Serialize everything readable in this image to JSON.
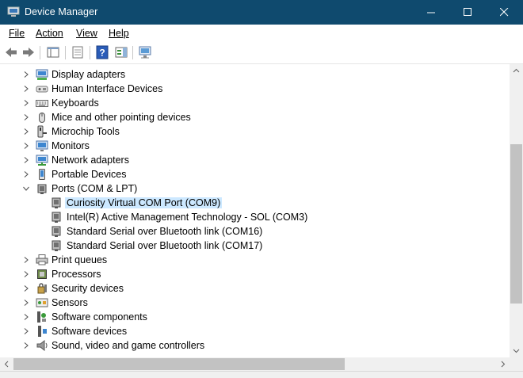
{
  "window": {
    "title": "Device Manager"
  },
  "menu": [
    {
      "label": "File"
    },
    {
      "label": "Action"
    },
    {
      "label": "View"
    },
    {
      "label": "Help"
    }
  ],
  "tree": {
    "items": [
      {
        "label": "Display adapters",
        "icon": "display-adapter-icon"
      },
      {
        "label": "Human Interface Devices",
        "icon": "hid-icon"
      },
      {
        "label": "Keyboards",
        "icon": "keyboard-icon"
      },
      {
        "label": "Mice and other pointing devices",
        "icon": "mouse-icon"
      },
      {
        "label": "Microchip Tools",
        "icon": "microchip-tool-icon"
      },
      {
        "label": "Monitors",
        "icon": "monitor-icon"
      },
      {
        "label": "Network adapters",
        "icon": "network-adapter-icon"
      },
      {
        "label": "Portable Devices",
        "icon": "portable-device-icon"
      },
      {
        "label": "Ports (COM & LPT)",
        "icon": "port-icon",
        "expanded": true,
        "children": [
          {
            "label": "Curiosity Virtual COM Port (COM9)",
            "icon": "com-port-icon",
            "selected": true
          },
          {
            "label": "Intel(R) Active Management Technology - SOL (COM3)",
            "icon": "com-port-icon"
          },
          {
            "label": "Standard Serial over Bluetooth link (COM16)",
            "icon": "com-port-icon"
          },
          {
            "label": "Standard Serial over Bluetooth link (COM17)",
            "icon": "com-port-icon"
          }
        ]
      },
      {
        "label": "Print queues",
        "icon": "printer-icon"
      },
      {
        "label": "Processors",
        "icon": "processor-icon"
      },
      {
        "label": "Security devices",
        "icon": "security-device-icon"
      },
      {
        "label": "Sensors",
        "icon": "sensor-icon"
      },
      {
        "label": "Software components",
        "icon": "software-component-icon"
      },
      {
        "label": "Software devices",
        "icon": "software-device-icon"
      },
      {
        "label": "Sound, video and game controllers",
        "icon": "speaker-icon"
      }
    ]
  },
  "colors": {
    "titlebar": "#0f4a6e",
    "selection": "#cce8ff"
  }
}
